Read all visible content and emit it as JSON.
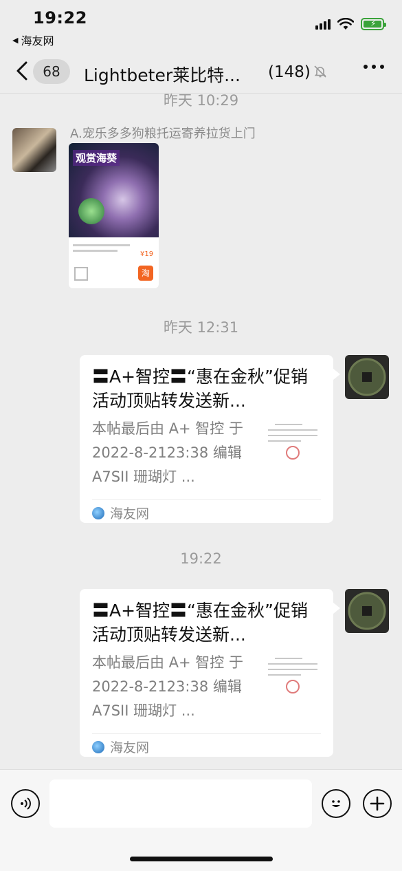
{
  "status_bar": {
    "time": "19:22",
    "back_app": "海友网"
  },
  "nav": {
    "unread_badge": "68",
    "title": "Lightbeter莱比特...",
    "member_count": "(148)"
  },
  "timestamps": [
    "昨天 10:29",
    "昨天 12:31",
    "19:22"
  ],
  "messages": [
    {
      "sender": "A.宠乐多多狗粮托运寄养拉货上门",
      "mini_program": {
        "headline": "观赏海葵",
        "price": "¥19"
      }
    },
    {
      "title": "〓A+智控〓“惠在金秋”促销活动顶贴转发送新...",
      "description": "本帖最后由 A+ 智控 于 2022-8-2123:38 编辑 A7SII 珊瑚灯 ...",
      "source": "海友网"
    },
    {
      "title": "〓A+智控〓“惠在金秋”促销活动顶贴转发送新...",
      "description": "本帖最后由 A+ 智控 于 2022-8-2123:38 编辑 A7SII 珊瑚灯 ...",
      "source": "海友网"
    }
  ],
  "colors": {
    "background": "#ededed",
    "battery": "#3aa33a",
    "bubble": "#ffffff"
  }
}
